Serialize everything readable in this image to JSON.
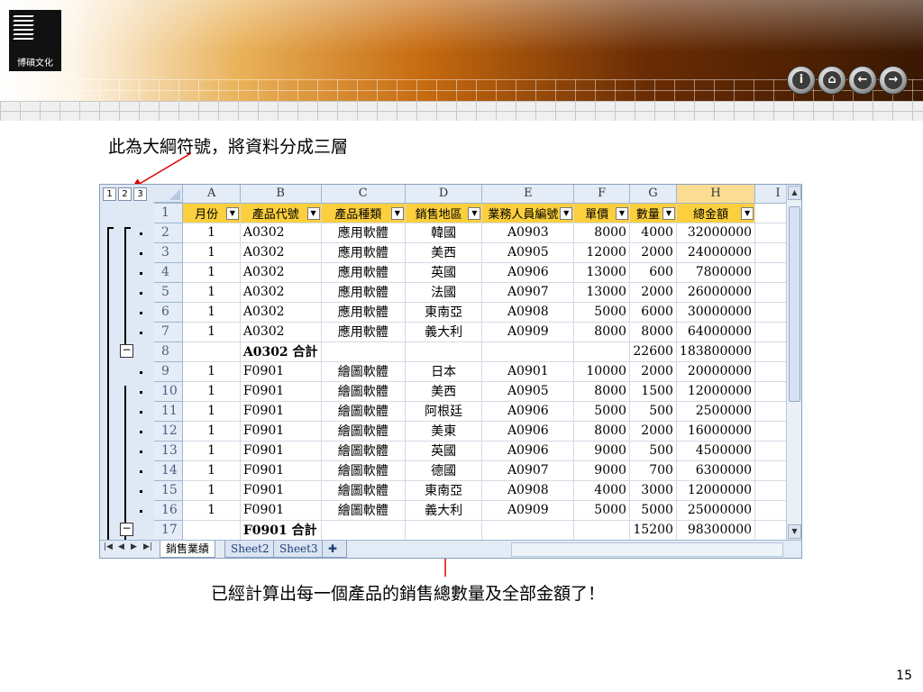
{
  "header": {
    "logo_text": "博碩文化",
    "nav_buttons": [
      {
        "icon": "info-icon",
        "glyph": "i"
      },
      {
        "icon": "home-icon",
        "glyph": "⌂"
      },
      {
        "icon": "arrow-left-icon",
        "glyph": "←"
      },
      {
        "icon": "arrow-right-icon",
        "glyph": "→"
      }
    ]
  },
  "annotations": {
    "top_note": "此為大綱符號，將資料分成三層",
    "bottom_note": "已經計算出每一個產品的銷售總數量及全部金額了！",
    "arrow_color": "#e00000"
  },
  "outline_levels": [
    "1",
    "2",
    "3"
  ],
  "spreadsheet": {
    "columns": [
      "A",
      "B",
      "C",
      "D",
      "E",
      "F",
      "G",
      "H",
      "I"
    ],
    "selected_column": "H",
    "headers": [
      "月份",
      "產品代號",
      "產品種類",
      "銷售地區",
      "業務人員編號",
      "單價",
      "數量",
      "總金額"
    ],
    "rows": [
      {
        "n": "1",
        "type": "header"
      },
      {
        "n": "2",
        "cells": [
          "1",
          "A0302",
          "應用軟體",
          "韓國",
          "A0903",
          "8000",
          "4000",
          "32000000"
        ]
      },
      {
        "n": "3",
        "cells": [
          "1",
          "A0302",
          "應用軟體",
          "美西",
          "A0905",
          "12000",
          "2000",
          "24000000"
        ]
      },
      {
        "n": "4",
        "cells": [
          "1",
          "A0302",
          "應用軟體",
          "英國",
          "A0906",
          "13000",
          "600",
          "7800000"
        ]
      },
      {
        "n": "5",
        "cells": [
          "1",
          "A0302",
          "應用軟體",
          "法國",
          "A0907",
          "13000",
          "2000",
          "26000000"
        ]
      },
      {
        "n": "6",
        "cells": [
          "1",
          "A0302",
          "應用軟體",
          "東南亞",
          "A0908",
          "5000",
          "6000",
          "30000000"
        ]
      },
      {
        "n": "7",
        "cells": [
          "1",
          "A0302",
          "應用軟體",
          "義大利",
          "A0909",
          "8000",
          "8000",
          "64000000"
        ]
      },
      {
        "n": "8",
        "subtotal": "A0302 合計",
        "qty": "22600",
        "total": "183800000"
      },
      {
        "n": "9",
        "cells": [
          "1",
          "F0901",
          "繪圖軟體",
          "日本",
          "A0901",
          "10000",
          "2000",
          "20000000"
        ]
      },
      {
        "n": "10",
        "cells": [
          "1",
          "F0901",
          "繪圖軟體",
          "美西",
          "A0905",
          "8000",
          "1500",
          "12000000"
        ]
      },
      {
        "n": "11",
        "cells": [
          "1",
          "F0901",
          "繪圖軟體",
          "阿根廷",
          "A0906",
          "5000",
          "500",
          "2500000"
        ]
      },
      {
        "n": "12",
        "cells": [
          "1",
          "F0901",
          "繪圖軟體",
          "美東",
          "A0906",
          "8000",
          "2000",
          "16000000"
        ]
      },
      {
        "n": "13",
        "cells": [
          "1",
          "F0901",
          "繪圖軟體",
          "英國",
          "A0906",
          "9000",
          "500",
          "4500000"
        ]
      },
      {
        "n": "14",
        "cells": [
          "1",
          "F0901",
          "繪圖軟體",
          "德國",
          "A0907",
          "9000",
          "700",
          "6300000"
        ]
      },
      {
        "n": "15",
        "cells": [
          "1",
          "F0901",
          "繪圖軟體",
          "東南亞",
          "A0908",
          "4000",
          "3000",
          "12000000"
        ]
      },
      {
        "n": "16",
        "cells": [
          "1",
          "F0901",
          "繪圖軟體",
          "義大利",
          "A0909",
          "5000",
          "5000",
          "25000000"
        ]
      },
      {
        "n": "17",
        "subtotal": "F0901 合計",
        "qty": "15200",
        "total": "98300000"
      }
    ],
    "sheet_tabs": [
      "銷售業績",
      "Sheet2",
      "Sheet3"
    ],
    "active_tab": "銷售業績"
  },
  "page_number": "15"
}
